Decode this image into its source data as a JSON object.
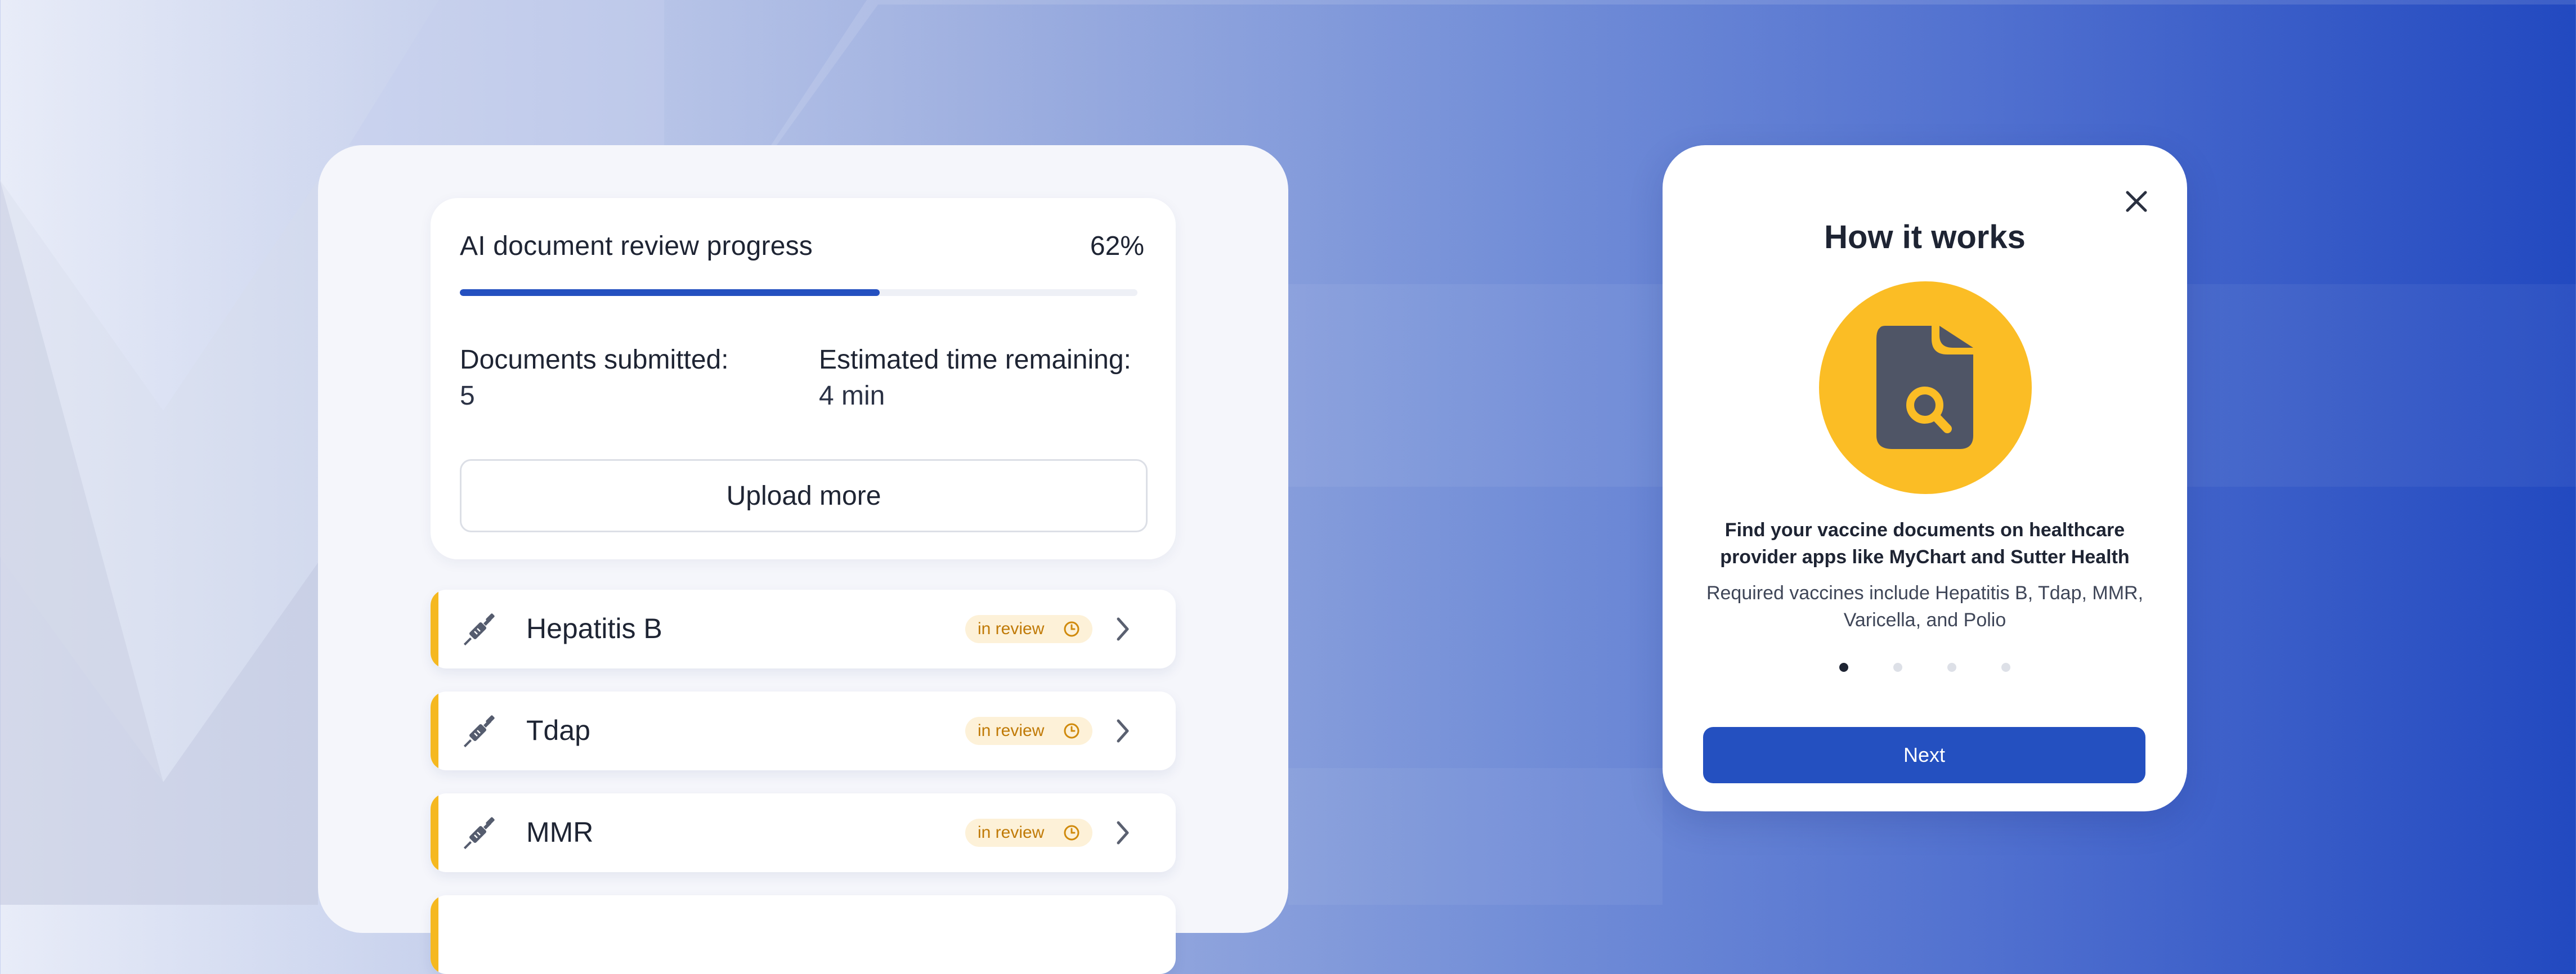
{
  "progress": {
    "title": "AI document review progress",
    "percent_label": "62%",
    "percent_value": 0.62,
    "submitted_label": "Documents submitted:",
    "submitted_value": "5",
    "remaining_label": "Estimated time remaining:",
    "remaining_value": "4 min",
    "upload_label": "Upload more"
  },
  "vaccines": [
    {
      "name": "Hepatitis B",
      "status": "in review"
    },
    {
      "name": "Tdap",
      "status": "in review"
    },
    {
      "name": "MMR",
      "status": "in review"
    }
  ],
  "modal": {
    "title": "How it works",
    "text_primary": "Find your vaccine documents on healthcare provider apps like MyChart and Sutter Health",
    "text_secondary": "Required vaccines include Hepatitis B, Tdap, MMR, Varicella, and Polio",
    "pagination_total": 4,
    "pagination_active": 1,
    "next_label": "Next"
  },
  "icons": {
    "close": "close-icon",
    "hero": "document-search-icon",
    "row": "syringe-icon",
    "badge": "clock-icon",
    "chevron": "chevron-right-icon"
  },
  "colors": {
    "accent_blue": "#2450c0",
    "accent_yellow": "#f5b820",
    "badge_bg": "#fdf1d8",
    "badge_text": "#c07a07",
    "hero_circle": "#fbbd25"
  }
}
